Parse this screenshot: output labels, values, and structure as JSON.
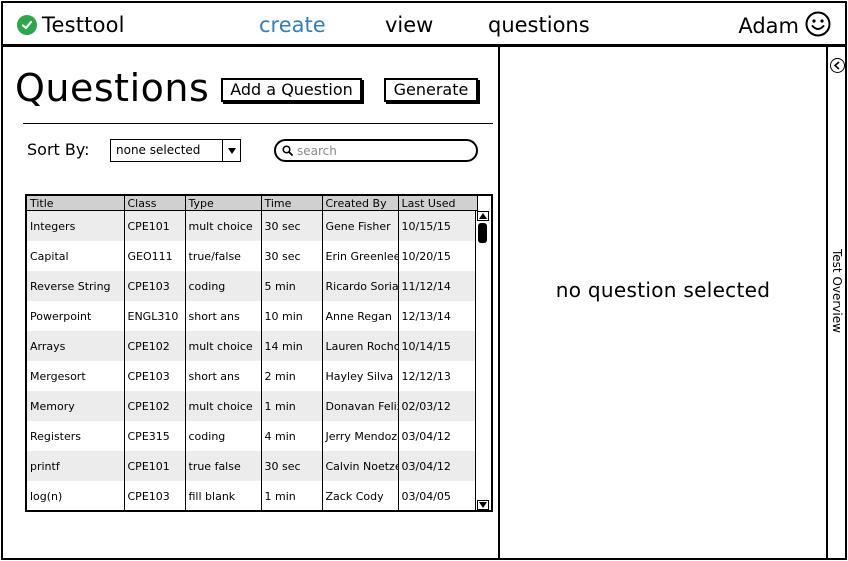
{
  "app": {
    "brand": "Testtool"
  },
  "nav": {
    "create": "create",
    "view": "view",
    "questions": "questions",
    "active": "create",
    "active_color": "#2f7fc4"
  },
  "user": {
    "name": "Adam",
    "icon": "smiley-icon"
  },
  "page": {
    "title": "Questions",
    "add_button": "Add a Question",
    "generate_button": "Generate"
  },
  "sort": {
    "label": "Sort By:",
    "value": "none selected"
  },
  "search": {
    "placeholder": "search"
  },
  "table": {
    "columns": [
      "Title",
      "Class",
      "Type",
      "Time",
      "Created By",
      "Last Used"
    ],
    "rows": [
      [
        "Integers",
        "CPE101",
        "mult choice",
        "30 sec",
        "Gene Fisher",
        "10/15/15"
      ],
      [
        "Capital",
        "GEO111",
        "true/false",
        "30 sec",
        "Erin Greenlee",
        "10/20/15"
      ],
      [
        "Reverse String",
        "CPE103",
        "coding",
        "5 min",
        "Ricardo Soriano",
        "11/12/14"
      ],
      [
        "Powerpoint",
        "ENGL310",
        "short ans",
        "10 min",
        "Anne Regan",
        "12/13/14"
      ],
      [
        "Arrays",
        "CPE102",
        "mult choice",
        "14 min",
        "Lauren Rochon",
        "10/14/15"
      ],
      [
        "Mergesort",
        "CPE103",
        "short ans",
        "2 min",
        "Hayley Silva",
        "12/12/13"
      ],
      [
        "Memory",
        "CPE102",
        "mult choice",
        "1 min",
        "Donavan Felix",
        "02/03/12"
      ],
      [
        "Registers",
        "CPE315",
        "coding",
        "4 min",
        "Jerry Mendoza",
        "03/04/12"
      ],
      [
        "printf",
        "CPE101",
        "true false",
        "30 sec",
        "Calvin Noetzel",
        "03/04/12"
      ],
      [
        "log(n)",
        "CPE103",
        "fill blank",
        "1 min",
        "Zack Cody",
        "03/04/05"
      ]
    ]
  },
  "detail": {
    "empty_message": "no question selected"
  },
  "overview": {
    "label": "Test Overview"
  },
  "colors": {
    "brand_check": "#2aa84a",
    "header_bg": "#d0d0d0",
    "row_alt": "#ececec"
  }
}
